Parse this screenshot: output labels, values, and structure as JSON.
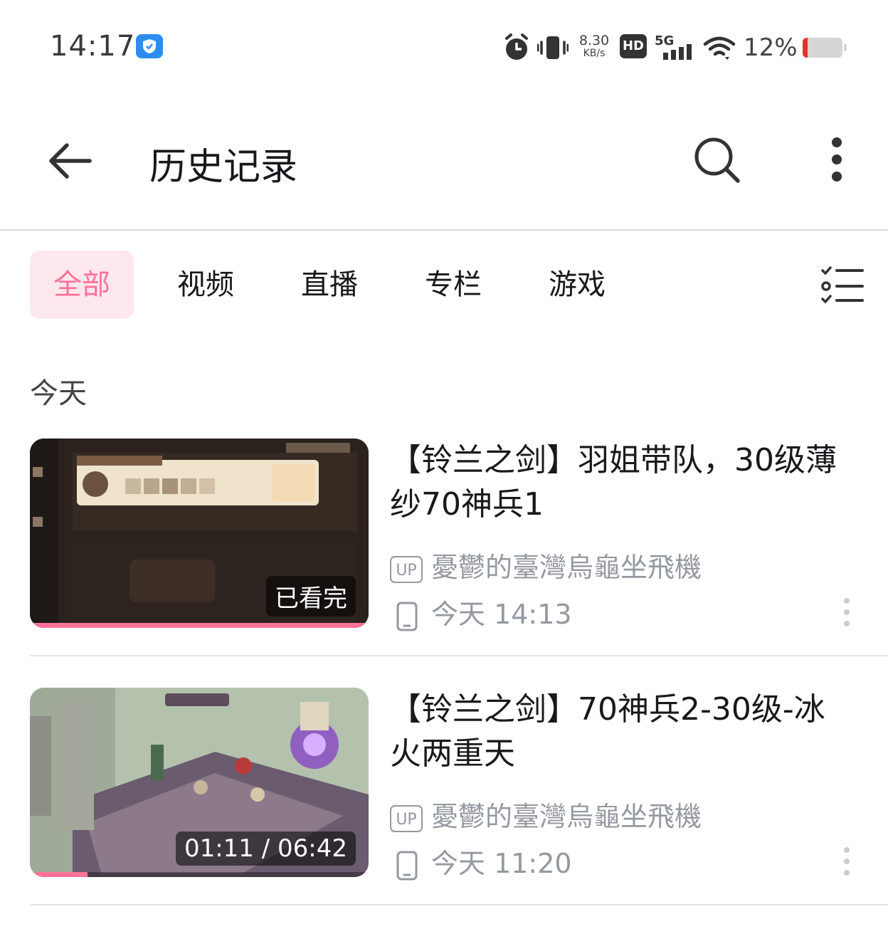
{
  "status_bar": {
    "time": "14:17",
    "network_speed_value": "8.30",
    "network_speed_unit": "KB/s",
    "hd_label": "HD",
    "signal_label": "5G",
    "battery_percent": "12%",
    "battery_level": 0.12,
    "icons": [
      "app-shield-icon",
      "alarm-icon",
      "vibrate-icon",
      "wifi-icon",
      "battery-icon"
    ]
  },
  "header": {
    "title": "历史记录",
    "icons": [
      "back-arrow-icon",
      "search-icon",
      "more-vertical-icon"
    ]
  },
  "tabs": [
    {
      "label": "全部",
      "active": true
    },
    {
      "label": "视频",
      "active": false
    },
    {
      "label": "直播",
      "active": false
    },
    {
      "label": "专栏",
      "active": false
    },
    {
      "label": "游戏",
      "active": false
    }
  ],
  "section": {
    "title": "今天"
  },
  "items": [
    {
      "title": "【铃兰之剑】羽姐带队，30级薄纱70神兵1",
      "up_tag": "UP",
      "author": "憂鬱的臺灣烏龜坐飛機",
      "device_icon": "phone-icon",
      "time": "今天 14:13",
      "badge": "已看完",
      "progress": 1.0
    },
    {
      "title": "【铃兰之剑】70神兵2-30级-冰火两重天",
      "up_tag": "UP",
      "author": "憂鬱的臺灣烏龜坐飛機",
      "device_icon": "phone-icon",
      "time": "今天 11:20",
      "badge": "01:11 / 06:42",
      "progress": 0.17
    }
  ],
  "colors": {
    "accent": "#fb7299",
    "tab_active_bg": "#fde8ed",
    "meta_text": "#9499a0",
    "battery_low": "#e5312b"
  }
}
